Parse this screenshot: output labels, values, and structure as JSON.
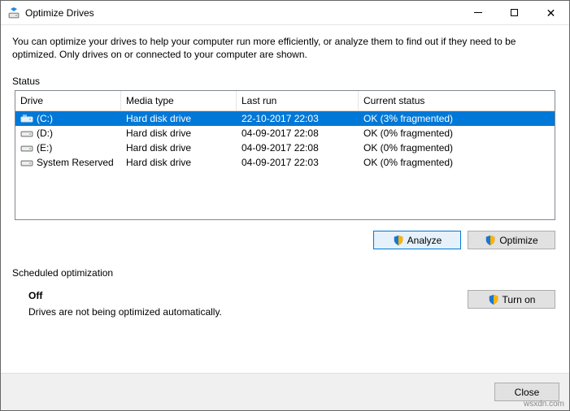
{
  "window": {
    "title": "Optimize Drives"
  },
  "description": "You can optimize your drives to help your computer run more efficiently, or analyze them to find out if they need to be optimized. Only drives on or connected to your computer are shown.",
  "status_label": "Status",
  "columns": {
    "drive": "Drive",
    "media": "Media type",
    "last": "Last run",
    "status": "Current status"
  },
  "drives": [
    {
      "name": "(C:)",
      "media": "Hard disk drive",
      "last": "22-10-2017 22:03",
      "status": "OK (3% fragmented)",
      "selected": true,
      "primary": true
    },
    {
      "name": "(D:)",
      "media": "Hard disk drive",
      "last": "04-09-2017 22:08",
      "status": "OK (0% fragmented)",
      "selected": false,
      "primary": false
    },
    {
      "name": "(E:)",
      "media": "Hard disk drive",
      "last": "04-09-2017 22:08",
      "status": "OK (0% fragmented)",
      "selected": false,
      "primary": false
    },
    {
      "name": "System Reserved",
      "media": "Hard disk drive",
      "last": "04-09-2017 22:03",
      "status": "OK (0% fragmented)",
      "selected": false,
      "primary": false
    }
  ],
  "buttons": {
    "analyze": "Analyze",
    "optimize": "Optimize",
    "turnon": "Turn on",
    "close": "Close"
  },
  "scheduled": {
    "label": "Scheduled optimization",
    "state": "Off",
    "desc": "Drives are not being optimized automatically."
  },
  "watermark": "wsxdn.com"
}
